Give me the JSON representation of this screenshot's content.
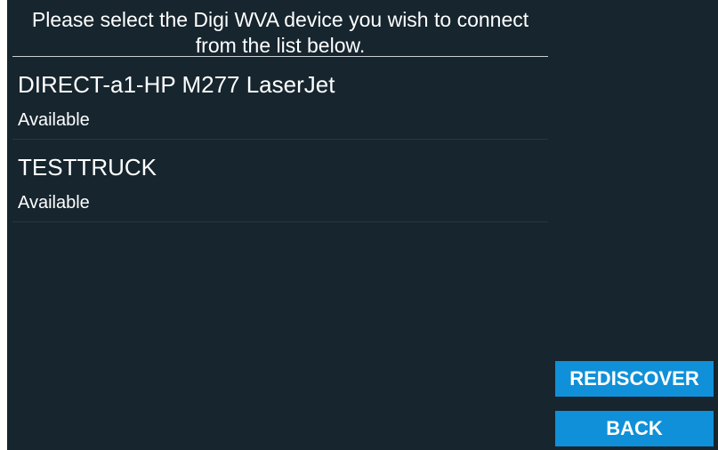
{
  "instructions": "Please select the Digi WVA device you wish to connect from the list below.",
  "devices": [
    {
      "name": "DIRECT-a1-HP M277 LaserJet",
      "status": "Available"
    },
    {
      "name": "TESTTRUCK",
      "status": "Available"
    }
  ],
  "buttons": {
    "rediscover": "REDISCOVER",
    "back": "BACK"
  },
  "colors": {
    "background": "#16252e",
    "button": "#1090d8",
    "text": "#ffffff"
  }
}
